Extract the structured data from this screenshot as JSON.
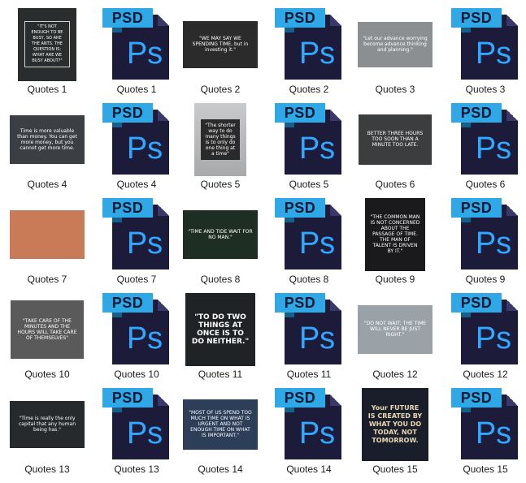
{
  "tag_text": "PSD",
  "ps_text": "Ps",
  "colors": {
    "psd_page": "#1d1b3a",
    "psd_tag": "#2ea8e6",
    "ps_text": "#31a8ff"
  },
  "items": [
    {
      "label": "Quotes 1",
      "type": "image",
      "quote": "\"IT'S NOT ENOUGH TO BE BUSY, SO ARE THE ANTS. THE QUESTION IS: WHAT ARE WE BUSY ABOUT?\"",
      "w": 72,
      "h": 90,
      "bg": "#2a2d2e",
      "style": "big-small"
    },
    {
      "label": "Quotes 1",
      "type": "psd"
    },
    {
      "label": "Quotes 2",
      "type": "image",
      "quote": "\"WE MAY SAY WE SPENDING TIME, but in investing it.\"",
      "w": 92,
      "h": 58,
      "bg": "#2b2b2b",
      "style": "small"
    },
    {
      "label": "Quotes 2",
      "type": "psd"
    },
    {
      "label": "Quotes 3",
      "type": "image",
      "quote": "\"Let our advance worrying become advance thinking and planning.\"",
      "w": 92,
      "h": 56,
      "bg": "#8c8f92",
      "style": "small"
    },
    {
      "label": "Quotes 3",
      "type": "psd"
    },
    {
      "label": "Quotes 4",
      "type": "image",
      "quote": "Time is more valuable than money. You can get more money, but you cannot get more time.",
      "w": 92,
      "h": 60,
      "bg": "#3b3f44",
      "style": "small"
    },
    {
      "label": "Quotes 4",
      "type": "psd"
    },
    {
      "label": "Quotes 5",
      "type": "image",
      "quote": "\"The shorter way to do many things is to only do one thing at a time\"",
      "w": 64,
      "h": 90,
      "bg": "#b8b9ba",
      "style": "box"
    },
    {
      "label": "Quotes 5",
      "type": "psd"
    },
    {
      "label": "Quotes 6",
      "type": "image",
      "quote": "BETTER THREE HOURS TOO SOON THAN A MINUTE TOO LATE.",
      "w": 90,
      "h": 62,
      "bg": "#3c3d3e",
      "style": "small"
    },
    {
      "label": "Quotes 6",
      "type": "psd"
    },
    {
      "label": "Quotes 7",
      "type": "image",
      "quote": "",
      "w": 92,
      "h": 60,
      "bg": "#c97a56",
      "style": "small"
    },
    {
      "label": "Quotes 7",
      "type": "psd"
    },
    {
      "label": "Quotes 8",
      "type": "image",
      "quote": "\"TIME AND TIDE WAIT FOR NO MAN.\"",
      "w": 92,
      "h": 60,
      "bg": "#1f2e22",
      "style": "small"
    },
    {
      "label": "Quotes 8",
      "type": "psd"
    },
    {
      "label": "Quotes 9",
      "type": "image",
      "quote": "\"THE COMMON MAN IS NOT CONCERNED ABOUT THE PASSAGE OF TIME. THE MAN OF TALENT IS DRIVEN BY IT.\"",
      "w": 74,
      "h": 90,
      "bg": "#1a1a1c",
      "style": "small"
    },
    {
      "label": "Quotes 9",
      "type": "psd"
    },
    {
      "label": "Quotes 10",
      "type": "image",
      "quote": "\"TAKE CARE OF THE MINUTES AND THE HOURS WILL TAKE CARE OF THEMSELVES\"",
      "w": 90,
      "h": 72,
      "bg": "#5a5a5a",
      "style": "small"
    },
    {
      "label": "Quotes 10",
      "type": "psd"
    },
    {
      "label": "Quotes 11",
      "type": "image",
      "quote": "\"TO DO TWO THINGS AT ONCE IS TO DO NEITHER.\"",
      "w": 86,
      "h": 90,
      "bg": "#1f2326",
      "style": "big"
    },
    {
      "label": "Quotes 11",
      "type": "psd"
    },
    {
      "label": "Quotes 12",
      "type": "image",
      "quote": "\"DO NOT WAIT; THE TIME WILL NEVER BE JUST RIGHT.\"",
      "w": 92,
      "h": 60,
      "bg": "#9aa2a8",
      "style": "small"
    },
    {
      "label": "Quotes 12",
      "type": "psd"
    },
    {
      "label": "Quotes 13",
      "type": "image",
      "quote": "\"Time is really the only capital that any human being has.\"",
      "w": 92,
      "h": 58,
      "bg": "#272a2c",
      "style": "small"
    },
    {
      "label": "Quotes 13",
      "type": "psd"
    },
    {
      "label": "Quotes 14",
      "type": "image",
      "quote": "\"MOST OF US SPEND TOO MUCH TIME ON WHAT IS URGENT AND NOT ENOUGH TIME ON WHAT IS IMPORTANT.\"",
      "w": 92,
      "h": 62,
      "bg": "#2c3e58",
      "style": "small"
    },
    {
      "label": "Quotes 14",
      "type": "psd"
    },
    {
      "label": "Quotes 15",
      "type": "image",
      "quote": "Your FUTURE IS CREATED BY WHAT YOU DO TODAY, NOT TOMORROW.",
      "w": 82,
      "h": 90,
      "bg": "#1a1e2a",
      "style": "box-dark"
    },
    {
      "label": "Quotes 15",
      "type": "psd"
    }
  ]
}
